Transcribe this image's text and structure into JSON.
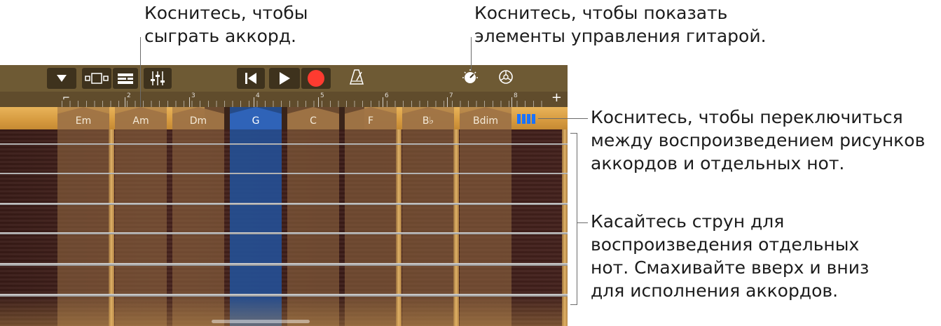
{
  "callouts": {
    "play_chord": [
      "Коснитесь, чтобы",
      "сыграть аккорд."
    ],
    "guitar_controls": [
      "Коснитесь, чтобы показать",
      "элементы управления гитарой."
    ],
    "switch_mode": [
      "Коснитесь, чтобы переключиться",
      "между воспроизведением рисунков",
      "аккордов и отдельных нот."
    ],
    "strings": [
      "Касайтесь струн для",
      "воспроизведения отдельных",
      "нот. Смахивайте вверх и вниз",
      "для исполнения аккордов."
    ]
  },
  "toolbar": {
    "icons": [
      "dropdown-icon",
      "view-toggle-icon",
      "tracks-icon",
      "mixer-icon",
      "rewind-icon",
      "play-icon",
      "record-icon",
      "metronome-icon",
      "guitar-controls-icon",
      "settings-icon"
    ],
    "record_color": "#ff3b30"
  },
  "ruler": {
    "bars": [
      "2",
      "3",
      "4",
      "5",
      "6",
      "7",
      "8"
    ],
    "add_label": "+"
  },
  "chords": [
    {
      "name": "Em",
      "active": false
    },
    {
      "name": "Am",
      "active": false
    },
    {
      "name": "Dm",
      "active": false
    },
    {
      "name": "G",
      "active": true
    },
    {
      "name": "C",
      "active": false
    },
    {
      "name": "F",
      "active": false
    },
    {
      "name": "B♭",
      "active": false
    },
    {
      "name": "Bdim",
      "active": false
    }
  ],
  "strings_count": 6,
  "colors": {
    "active_chord": "#2f63b8",
    "toggle_accent": "#1a73ff"
  }
}
